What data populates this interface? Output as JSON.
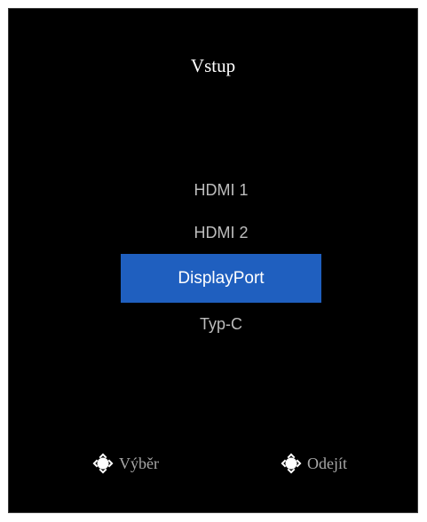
{
  "osd": {
    "title": "Vstup",
    "items": [
      {
        "label": "HDMI 1",
        "selected": false
      },
      {
        "label": "HDMI 2",
        "selected": false
      },
      {
        "label": "DisplayPort",
        "selected": true
      },
      {
        "label": "Typ-C",
        "selected": false
      }
    ],
    "hints": {
      "select_label": "Výběr",
      "select_icon": "joystick-up-down-icon",
      "exit_label": "Odejít",
      "exit_icon": "joystick-left-icon"
    },
    "colors": {
      "background": "#000000",
      "highlight": "#1f5fbf",
      "text_selected": "#ffffff",
      "text_normal": "#bdbdbd"
    }
  }
}
